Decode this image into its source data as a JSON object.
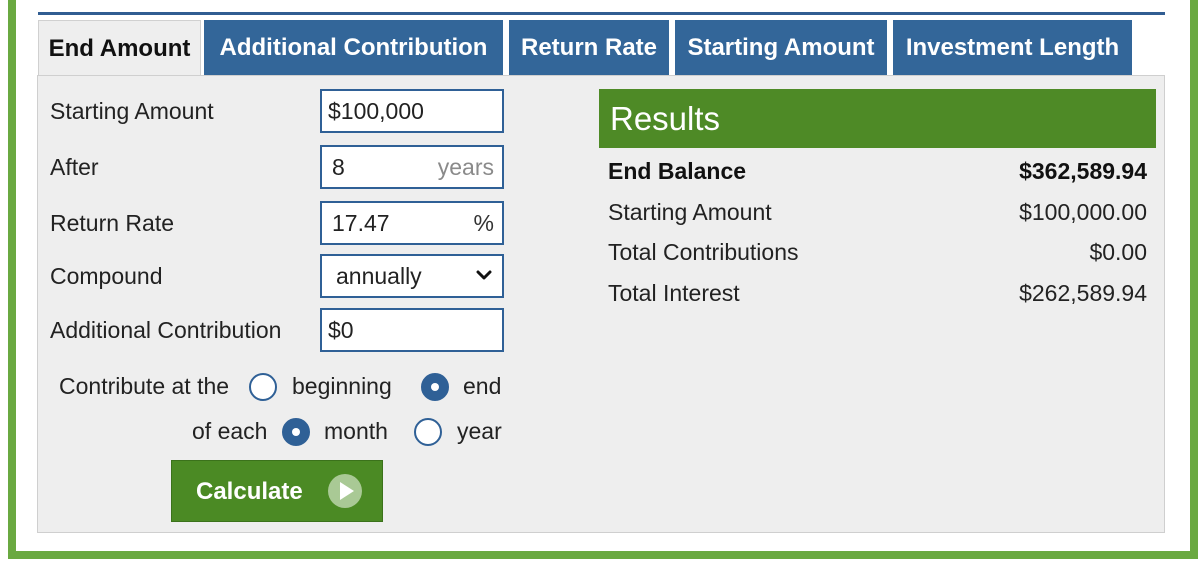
{
  "tabs": [
    {
      "label": "End Amount",
      "active": true
    },
    {
      "label": "Additional Contribution",
      "active": false
    },
    {
      "label": "Return Rate",
      "active": false
    },
    {
      "label": "Starting Amount",
      "active": false
    },
    {
      "label": "Investment Length",
      "active": false
    }
  ],
  "form": {
    "starting_amount": {
      "label": "Starting Amount",
      "value": "$100,000"
    },
    "after": {
      "label": "After",
      "value": "8",
      "unit": "years"
    },
    "return_rate": {
      "label": "Return Rate",
      "value": "17.47",
      "unit": "%"
    },
    "compound": {
      "label": "Compound",
      "selected": "annually"
    },
    "additional_contribution": {
      "label": "Additional Contribution",
      "value": "$0"
    },
    "contribute_at": {
      "label": "Contribute at the",
      "option_beginning": "beginning",
      "option_end": "end",
      "selected": "end"
    },
    "of_each": {
      "label": "of each",
      "option_month": "month",
      "option_year": "year",
      "selected": "month"
    },
    "calculate_label": "Calculate"
  },
  "results": {
    "title": "Results",
    "rows": [
      {
        "label": "End Balance",
        "value": "$362,589.94",
        "bold": true
      },
      {
        "label": "Starting Amount",
        "value": "$100,000.00"
      },
      {
        "label": "Total Contributions",
        "value": "$0.00"
      },
      {
        "label": "Total Interest",
        "value": "$262,589.94"
      }
    ]
  },
  "colors": {
    "frame_green": "#6aa941",
    "tab_blue": "#336699",
    "results_green": "#4e8a26",
    "panel_gray": "#eeeeee"
  },
  "icons": {
    "compound_select": "chevron-down-icon",
    "calculate_button": "play-circle-icon"
  }
}
